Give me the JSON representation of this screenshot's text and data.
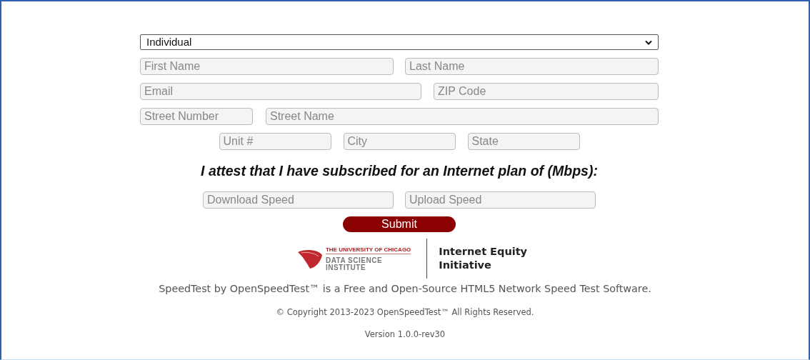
{
  "select": {
    "value": "Individual"
  },
  "field_rows": [
    [
      {
        "placeholder": "First Name"
      },
      {
        "placeholder": "Last Name"
      }
    ],
    [
      {
        "placeholder": "Email"
      },
      {
        "placeholder": "ZIP Code"
      }
    ],
    [
      {
        "placeholder": "Street Number"
      },
      {
        "placeholder": "Street Name"
      }
    ],
    [
      {
        "placeholder": "Unit #"
      },
      {
        "placeholder": "City"
      },
      {
        "placeholder": "State"
      }
    ]
  ],
  "attestation": "I attest that I have subscribed for an Internet plan of (Mbps):",
  "speed_fields": [
    {
      "placeholder": "Download Speed"
    },
    {
      "placeholder": "Upload Speed"
    }
  ],
  "submit": "Submit",
  "logo": {
    "university": "THE UNIVERSITY OF CHICAGO",
    "institute_lines": [
      "DATA SCIENCE",
      "INSTITUTE"
    ],
    "initiative_lines": [
      "Internet Equity",
      "Initiative"
    ]
  },
  "footer": [
    "SpeedTest by OpenSpeedTest™ is a Free and Open-Source HTML5 Network Speed Test Software.",
    "© Copyright 2013-2023 OpenSpeedTest™ All Rights Reserved.",
    "Version 1.0.0-rev30"
  ]
}
